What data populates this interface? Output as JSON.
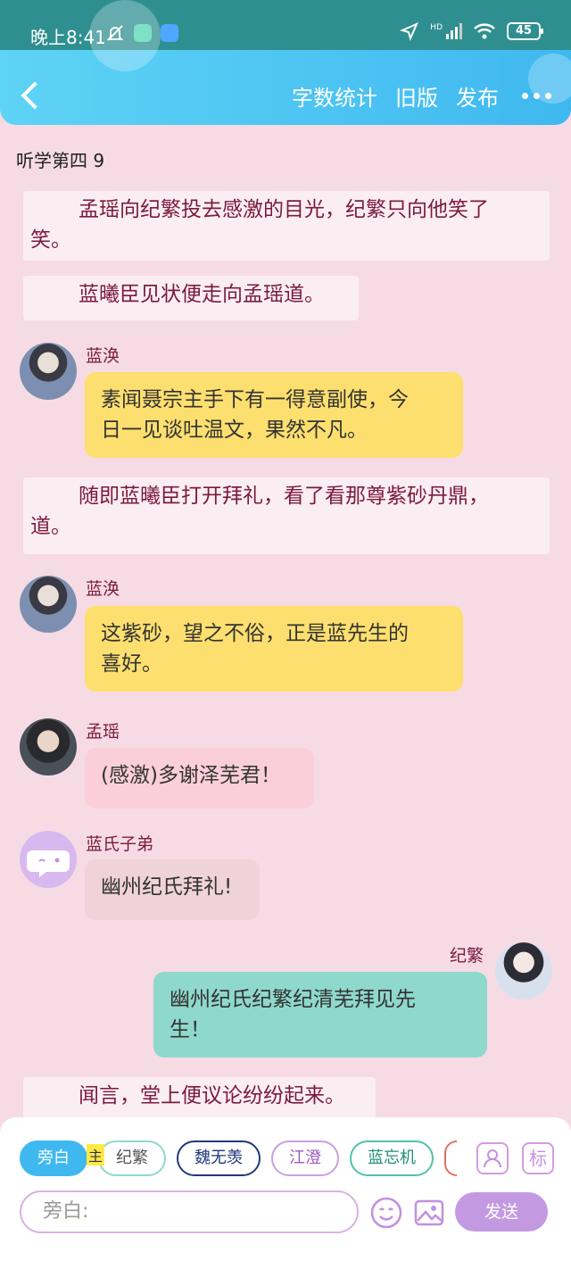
{
  "status_bar": {
    "time": "晚上8:41",
    "network": "HD",
    "battery": "45"
  },
  "header": {
    "word_count": "字数统计",
    "old_version": "旧版",
    "publish": "发布"
  },
  "chapter_title": "听学第四 9",
  "narrations": [
    {
      "line1": "孟瑶向纪繁投去感激的目光，纪繁只向他笑了",
      "line2": "笑。"
    },
    {
      "line1": "蓝曦臣见状便走向孟瑶道。"
    },
    {
      "line1": "随即蓝曦臣打开拜礼，看了看那尊紫砂丹鼎，",
      "line2": "道。"
    },
    {
      "line1": "闻言，堂上便议论纷纷起来。"
    }
  ],
  "messages": [
    {
      "name": "蓝涣",
      "line1": "素闻聂宗主手下有一得意副使，今",
      "line2": "日一见谈吐温文，果然不凡。"
    },
    {
      "name": "蓝涣",
      "line1": "这紫砂，望之不俗，正是蓝先生的",
      "line2": "喜好。"
    },
    {
      "name": "孟瑶",
      "line1": "(感激)多谢泽芜君！"
    },
    {
      "name": "蓝氏子弟",
      "line1": "幽州纪氏拜礼!"
    },
    {
      "name": "纪繁",
      "line1": "幽州纪氏纪繁纪清芜拜见先",
      "line2": "生！"
    }
  ],
  "composer": {
    "roles": [
      "旁白",
      "纪繁",
      "魏无羡",
      "江澄",
      "蓝忘机"
    ],
    "main_tag": "主",
    "label_btn": "标",
    "input_placeholder": "旁白:",
    "send": "发送"
  },
  "colors": {
    "header": "#3fb8f0",
    "background": "#f6dbe4",
    "narration_text": "#7b1a3f",
    "bubble_yellow": "#fddf6f",
    "bubble_pink": "#fbcfd9",
    "bubble_beige": "#efd3d9",
    "bubble_teal": "#8fd8cc",
    "send_button": "#c39ae2"
  }
}
